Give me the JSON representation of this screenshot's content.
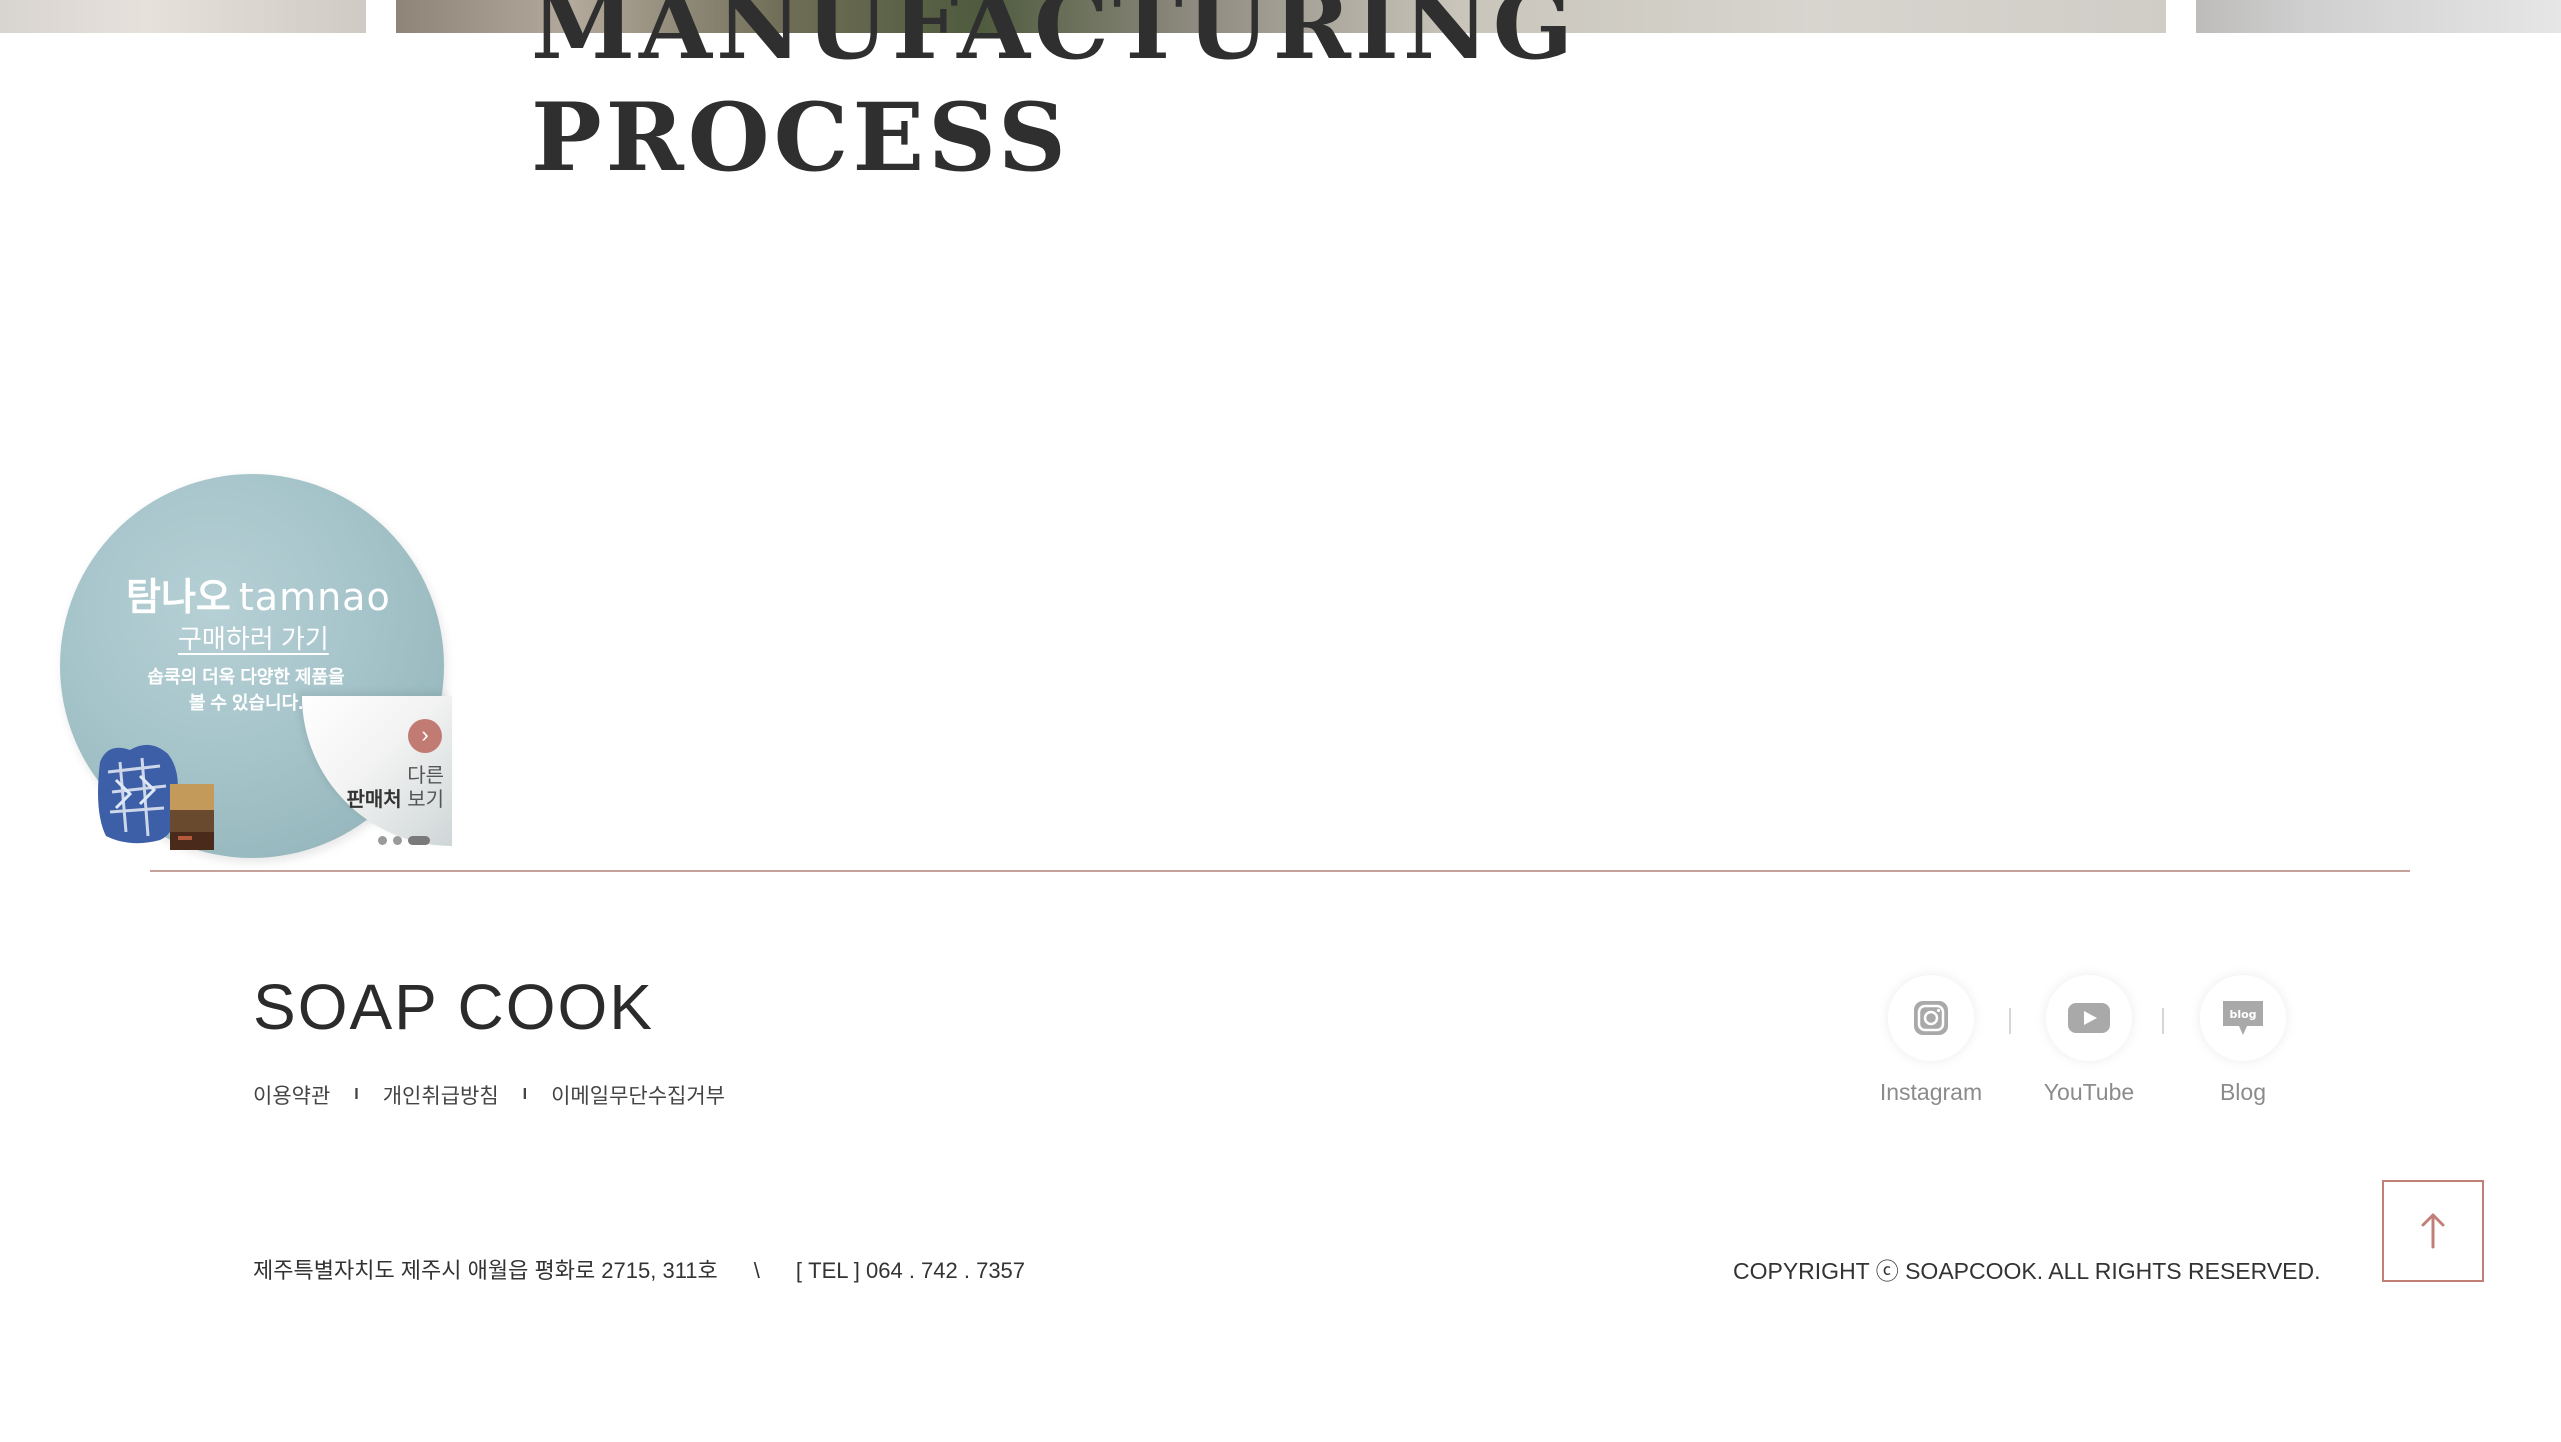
{
  "hero": {
    "title_line1": "MANUFACTURING",
    "title_line2": "PROCESS"
  },
  "banner": {
    "brand_ko": "탐나오",
    "brand_en": "tamnao",
    "link_label": "구매하러 가기",
    "desc_line1": "솝쿡의 더욱 다양한 제품을",
    "desc_line2": "볼 수 있습니다.",
    "more_line1": "다른",
    "more_bold": "판매처",
    "more_rest": " 보기",
    "arrow_icon": "chevron-right-icon",
    "slides": 3,
    "active_slide": 3,
    "colors": {
      "circle": "#a5c4ca",
      "arrow": "#c17b72"
    }
  },
  "footer": {
    "logo": "SOAP COOK",
    "links": [
      "이용약관",
      "개인취급방침",
      "이메일무단수집거부"
    ],
    "link_separator": "I",
    "social": [
      {
        "label": "Instagram",
        "icon": "instagram-icon"
      },
      {
        "label": "YouTube",
        "icon": "youtube-icon"
      },
      {
        "label": "Blog",
        "icon": "blog-icon"
      }
    ],
    "address": "제주특별자치도 제주시 애월읍 평화로 2715, 311호",
    "address_separator": "\\",
    "tel": "[ TEL ] 064 . 742 . 7357",
    "copyright": "COPYRIGHT ⓒ SOAPCOOK. ALL RIGHTS RESERVED.",
    "top_button_icon": "arrow-up-icon",
    "accent_color": "#c08078"
  }
}
